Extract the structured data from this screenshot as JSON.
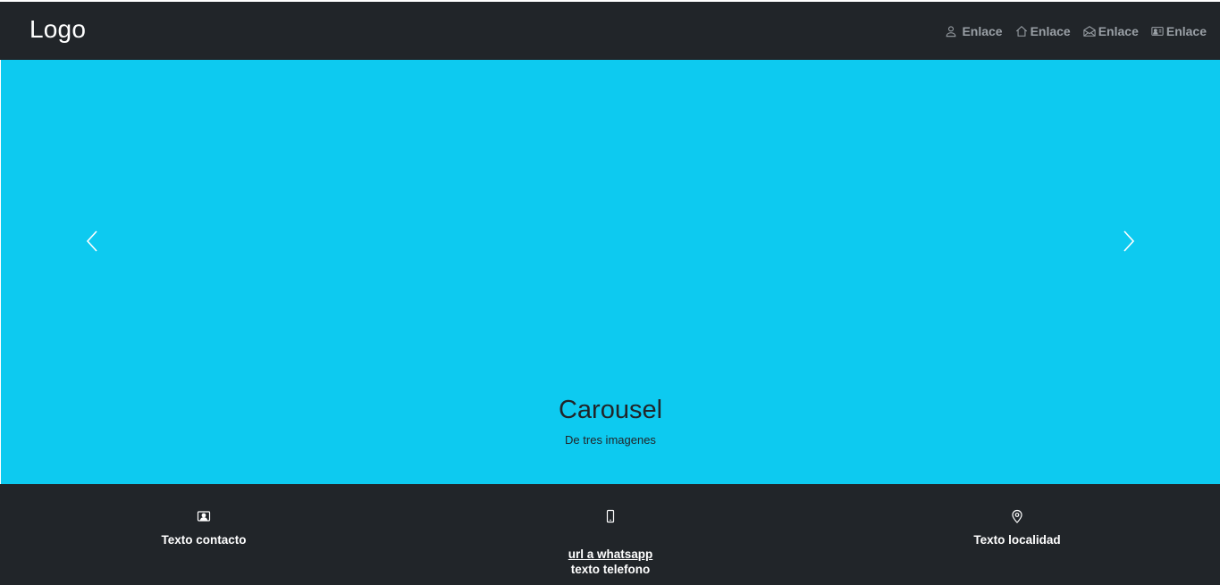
{
  "navbar": {
    "logo": "Logo",
    "links": [
      {
        "label": "Enlace",
        "icon": "person-icon"
      },
      {
        "label": "Enlace",
        "icon": "house-icon"
      },
      {
        "label": "Enlace",
        "icon": "envelope-open-icon"
      },
      {
        "label": "Enlace",
        "icon": "person-vcard-icon"
      }
    ]
  },
  "carousel": {
    "title": "Carousel",
    "subtitle": "De tres imagenes",
    "background": "#0dcaf0"
  },
  "footer": {
    "contact": {
      "icon": "person-badge-icon",
      "text": "Texto contacto"
    },
    "phone": {
      "icon": "phone-icon",
      "link": "url a whatsapp",
      "text": "texto telefono"
    },
    "location": {
      "icon": "geo-pin-icon",
      "text": "Texto localidad"
    }
  },
  "colors": {
    "navbar_bg": "#212529",
    "accent": "#0dcaf0",
    "footer_bg": "#212529"
  }
}
